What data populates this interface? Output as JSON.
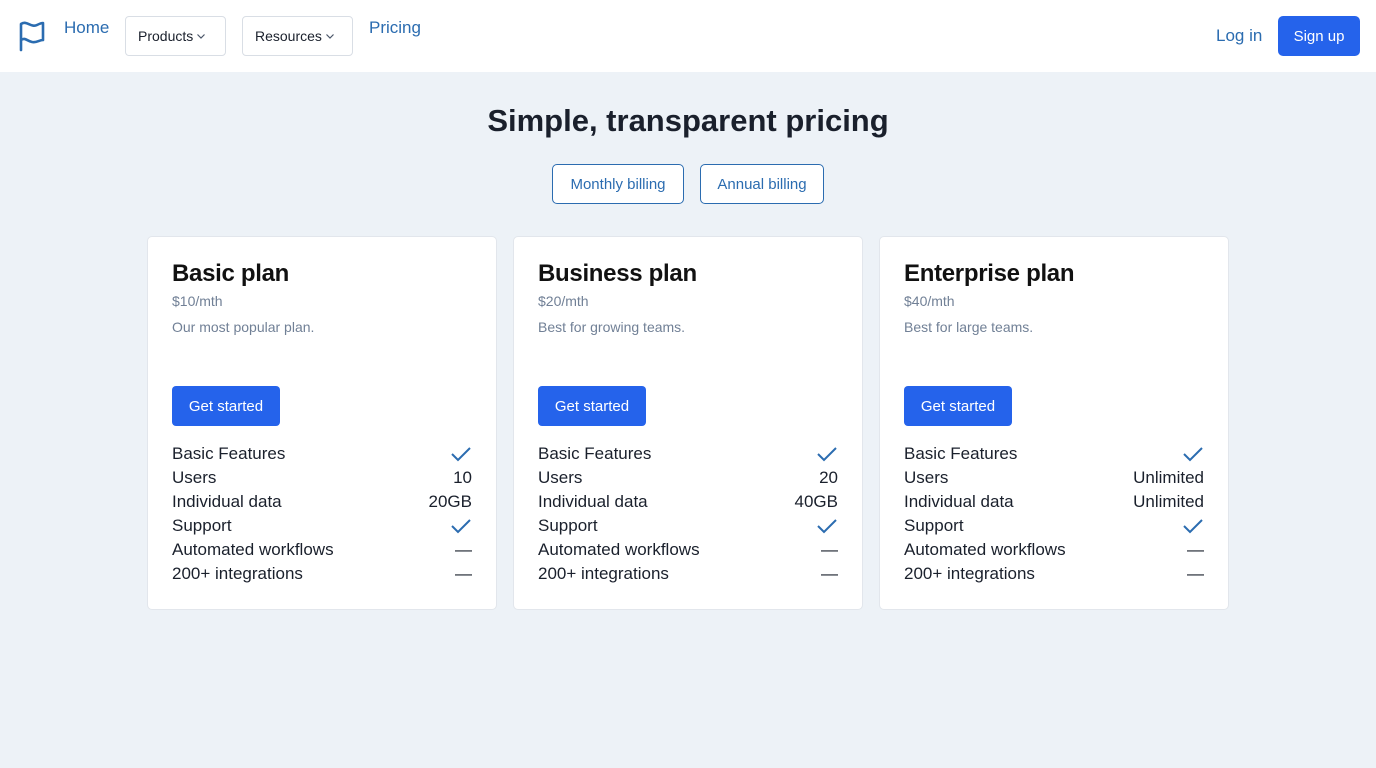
{
  "nav": {
    "logo_icon": "flag-icon",
    "home": "Home",
    "products": "Products",
    "resources": "Resources",
    "pricing": "Pricing",
    "login": "Log in",
    "signup": "Sign up"
  },
  "colors": {
    "accent": "#2563eb",
    "link": "#2b6cb0",
    "background": "#edf2f7"
  },
  "heading": "Simple, transparent pricing",
  "billing": {
    "monthly": "Monthly billing",
    "annual": "Annual billing"
  },
  "plans": [
    {
      "name": "Basic plan",
      "price": "$10/mth",
      "desc": "Our most popular plan.",
      "cta": "Get started",
      "features": [
        {
          "label": "Basic Features",
          "value": "check"
        },
        {
          "label": "Users",
          "value": "10"
        },
        {
          "label": "Individual data",
          "value": "20GB"
        },
        {
          "label": "Support",
          "value": "check"
        },
        {
          "label": "Automated workflows",
          "value": "—"
        },
        {
          "label": "200+ integrations",
          "value": "—"
        }
      ]
    },
    {
      "name": "Business plan",
      "price": "$20/mth",
      "desc": "Best for growing teams.",
      "cta": "Get started",
      "features": [
        {
          "label": "Basic Features",
          "value": "check"
        },
        {
          "label": "Users",
          "value": "20"
        },
        {
          "label": "Individual data",
          "value": "40GB"
        },
        {
          "label": "Support",
          "value": "check"
        },
        {
          "label": "Automated workflows",
          "value": "—"
        },
        {
          "label": "200+ integrations",
          "value": "—"
        }
      ]
    },
    {
      "name": "Enterprise plan",
      "price": "$40/mth",
      "desc": "Best for large teams.",
      "cta": "Get started",
      "features": [
        {
          "label": "Basic Features",
          "value": "check"
        },
        {
          "label": "Users",
          "value": "Unlimited"
        },
        {
          "label": "Individual data",
          "value": "Unlimited"
        },
        {
          "label": "Support",
          "value": "check"
        },
        {
          "label": "Automated workflows",
          "value": "—"
        },
        {
          "label": "200+ integrations",
          "value": "—"
        }
      ]
    }
  ]
}
